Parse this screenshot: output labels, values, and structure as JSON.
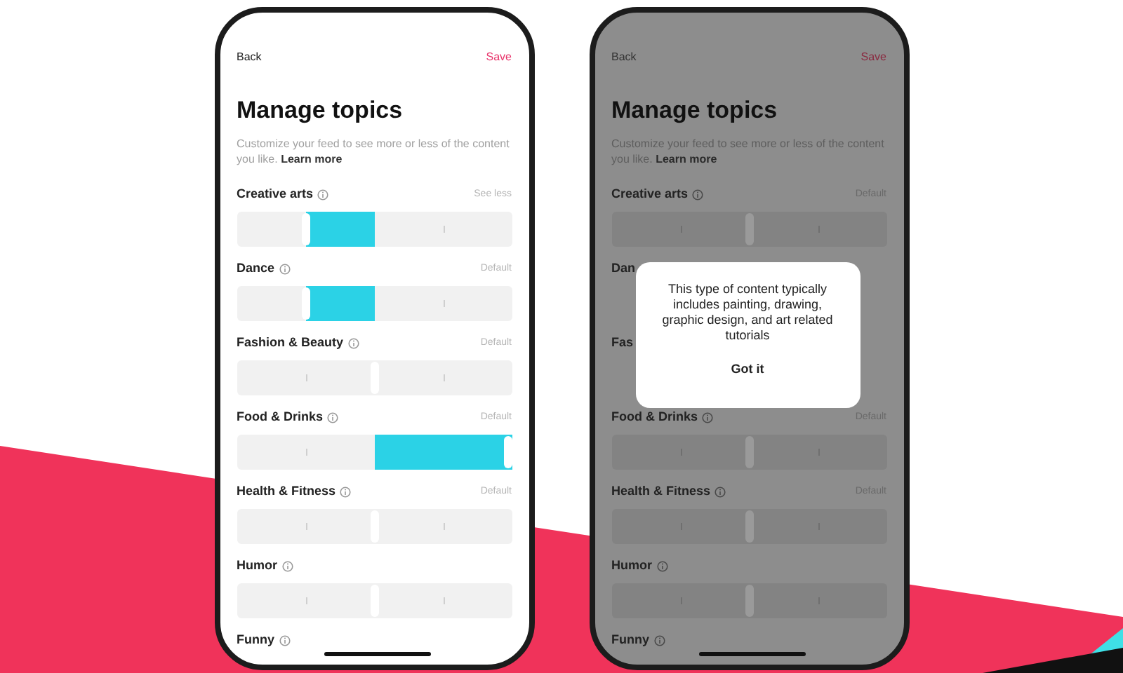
{
  "phones": [
    {
      "dimmed": false,
      "back": "Back",
      "save": "Save",
      "title": "Manage topics",
      "description": "Customize your feed to see more or less of the content you like.",
      "learn_more": "Learn more",
      "topics": [
        {
          "label": "Creative arts",
          "status": "See less",
          "level": 0.25
        },
        {
          "label": "Dance",
          "status": "Default",
          "level": 0.25
        },
        {
          "label": "Fashion & Beauty",
          "status": "Default",
          "level": 0.5
        },
        {
          "label": "Food & Drinks",
          "status": "Default",
          "level": 1
        },
        {
          "label": "Health & Fitness",
          "status": "Default",
          "level": 0.5
        },
        {
          "label": "Humor",
          "level": 0.5
        },
        {
          "label": "Funny"
        }
      ]
    },
    {
      "dimmed": true,
      "back": "Back",
      "save": "Save",
      "title": "Manage topics",
      "description": "Customize your feed to see more or less of the content you like.",
      "learn_more": "Learn more",
      "topics": [
        {
          "label": "Creative arts",
          "status": "Default",
          "level": 0.5
        },
        {
          "label": "Dan"
        },
        {
          "label": "Fas"
        },
        {
          "label": "Food & Drinks",
          "status": "Default",
          "level": 0.5
        },
        {
          "label": "Health & Fitness",
          "status": "Default",
          "level": 0.5
        },
        {
          "label": "Humor",
          "level": 0.5
        },
        {
          "label": "Funny"
        }
      ],
      "dialog": {
        "text": "This type of content typically includes painting, drawing, graphic design, and art related tutorials",
        "button": "Got it"
      }
    }
  ]
}
